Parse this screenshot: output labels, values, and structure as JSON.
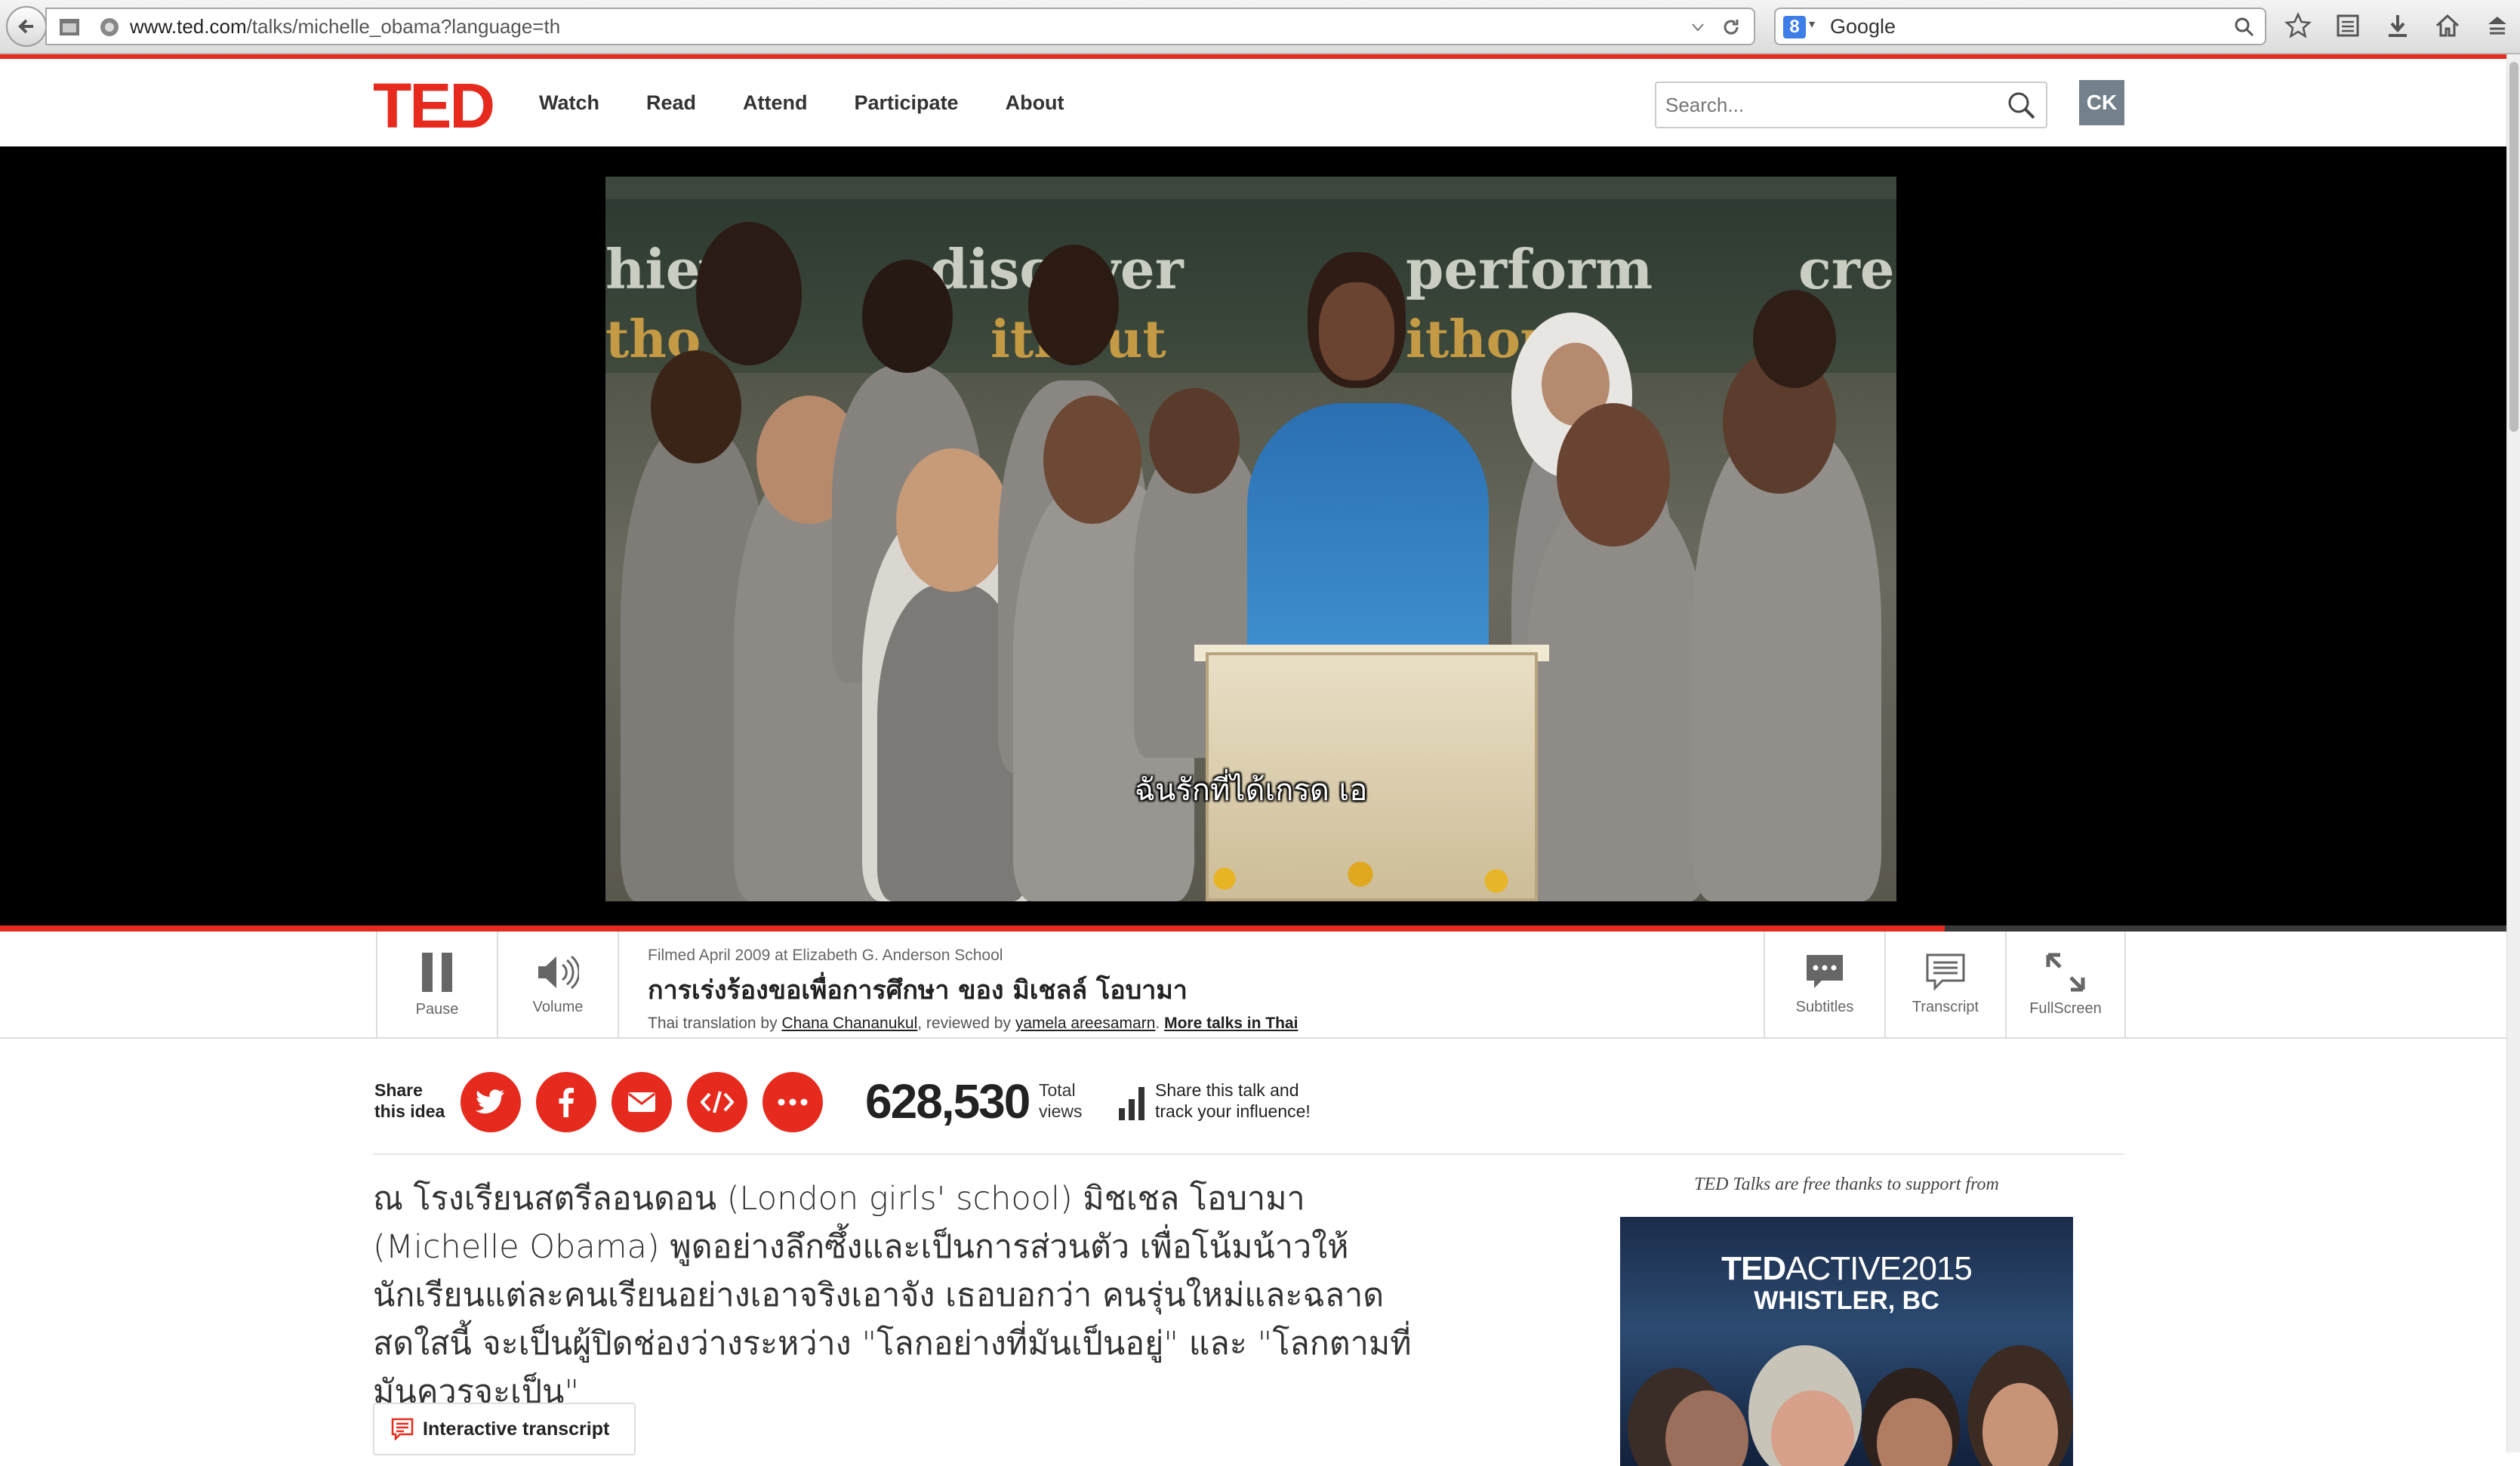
{
  "browser": {
    "url_host": "www.ted.com",
    "url_path": "/talks/michelle_obama?language=th",
    "search_engine": "Google",
    "search_badge": "8"
  },
  "header": {
    "logo": "TED",
    "nav": [
      "Watch",
      "Read",
      "Attend",
      "Participate",
      "About"
    ],
    "search_placeholder": "Search...",
    "avatar_initials": "CK"
  },
  "video": {
    "subtitle": "ฉันรักที่ได้เกรด เอ",
    "banner_words": [
      "hiev",
      "discover",
      "perform",
      "cre"
    ],
    "banner_words_lower": [
      "tho",
      "ithout",
      "ithou"
    ],
    "progress": 0.776
  },
  "controls": {
    "pause_label": "Pause",
    "volume_label": "Volume",
    "filmed": "Filmed April 2009 at Elizabeth G. Anderson School",
    "title": "การเร่งร้องขอเพื่อการศึกษา ของ มิเชลล์ โอบามา",
    "translation_prefix": "Thai translation by ",
    "translator": "Chana Chananukul",
    "reviewed_prefix": ", reviewed by ",
    "reviewer": "yamela areesamarn",
    "more_talks": "More talks in Thai",
    "subtitles_label": "Subtitles",
    "transcript_label": "Transcript",
    "fullscreen_label": "FullScreen"
  },
  "share": {
    "label_line1": "Share",
    "label_line2": "this idea",
    "views": "628,530",
    "views_line1": "Total",
    "views_line2": "views",
    "influence_line1": "Share this talk and",
    "influence_line2": "track your influence!"
  },
  "description": "ณ โรงเรียนสตรีลอนดอน (London girls' school) มิชเชล โอบามา (Michelle Obama) พูดอย่างลึกซึ้งและเป็นการส่วนตัว เพื่อโน้มน้าวให้นักเรียนแต่ละคนเรียนอย่างเอาจริงเอาจัง เธอบอกว่า คนรุ่นใหม่และฉลาดสดใสนี้ จะเป็นผู้ปิดช่องว่างระหว่าง \"โลกอย่างที่มันเป็นอยู่\" และ \"โลกตามที่มันควรจะเป็น\"",
  "transcript_button": "Interactive transcript",
  "sponsor": {
    "note": "TED Talks are free thanks to support from",
    "ad_brand_bold": "TED",
    "ad_brand_light": "ACTIVE2015",
    "ad_location": "WHISTLER, BC"
  },
  "colors": {
    "ted_red": "#e62b1e",
    "avatar_gray": "#74818c"
  }
}
